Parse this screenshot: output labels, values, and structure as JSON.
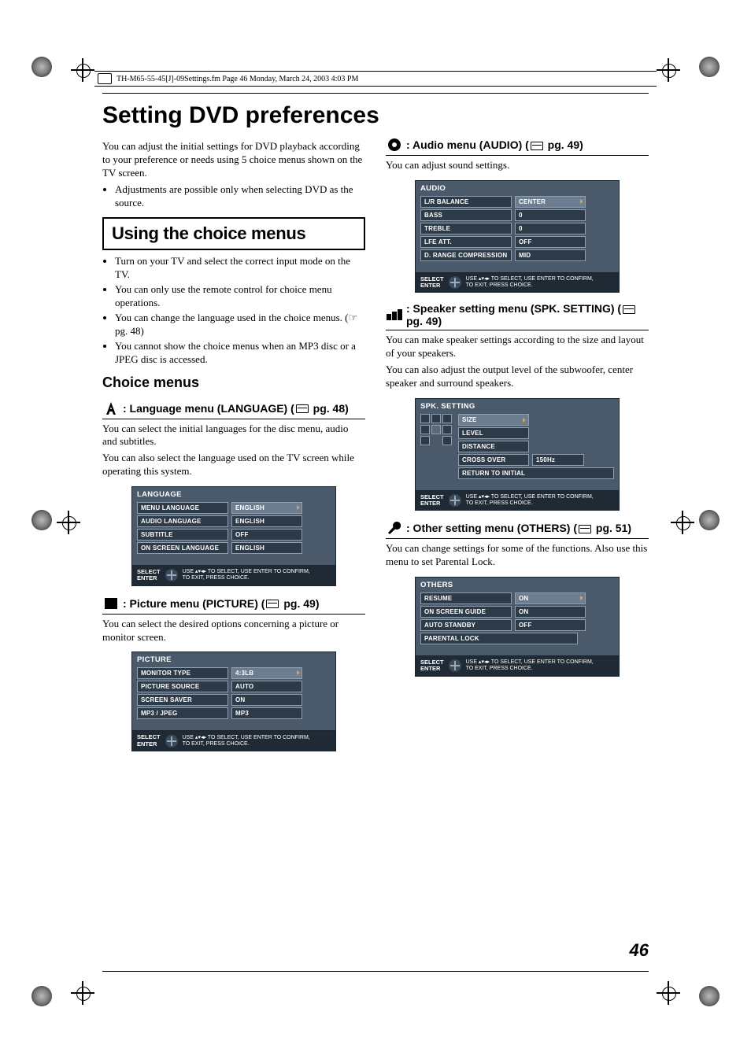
{
  "header_meta": "TH-M65-55-45[J]-09Settings.fm  Page 46  Monday, March 24, 2003  4:03 PM",
  "page_number": "46",
  "title": "Setting DVD preferences",
  "intro_p1": "You can adjust the initial settings for DVD playback according to your preference or needs using 5 choice menus shown on the TV screen.",
  "intro_bullet": "Adjustments are possible only when selecting DVD as the source.",
  "box_heading": "Using the choice menus",
  "box_bullets": [
    "Turn on your TV and select the correct input mode on the TV.",
    "You can only use the remote control for choice menu operations.",
    "You can change the language used in the choice menus. (☞ pg. 48)",
    "You cannot show the choice menus when an MP3 disc or a JPEG disc is accessed."
  ],
  "subheading": "Choice menus",
  "menus": {
    "language": {
      "heading_pre": ": Language menu (LANGUAGE) (",
      "heading_pg": " pg. 48)",
      "desc1": "You can select the initial languages for the disc menu, audio and subtitles.",
      "desc2": "You can also select the language used on the TV screen while operating this system.",
      "osd_title": "LANGUAGE",
      "rows": [
        {
          "label": "MENU LANGUAGE",
          "value": "ENGLISH",
          "hi": true
        },
        {
          "label": "AUDIO LANGUAGE",
          "value": "ENGLISH"
        },
        {
          "label": "SUBTITLE",
          "value": "OFF"
        },
        {
          "label": "ON SCREEN LANGUAGE",
          "value": "ENGLISH"
        }
      ]
    },
    "picture": {
      "heading_pre": ": Picture menu (PICTURE) (",
      "heading_pg": " pg. 49)",
      "desc1": "You can select the desired options concerning a picture or monitor screen.",
      "osd_title": "PICTURE",
      "rows": [
        {
          "label": "MONITOR TYPE",
          "value": "4:3LB",
          "hi": true
        },
        {
          "label": "PICTURE SOURCE",
          "value": "AUTO"
        },
        {
          "label": "SCREEN SAVER",
          "value": "ON"
        },
        {
          "label": "MP3 / JPEG",
          "value": "MP3"
        }
      ]
    },
    "audio": {
      "heading_pre": ": Audio menu (AUDIO) (",
      "heading_pg": " pg. 49)",
      "desc1": "You can adjust sound settings.",
      "osd_title": "AUDIO",
      "rows": [
        {
          "label": "L/R BALANCE",
          "value": "CENTER",
          "hi": true
        },
        {
          "label": "BASS",
          "value": "0"
        },
        {
          "label": "TREBLE",
          "value": "0"
        },
        {
          "label": "LFE ATT.",
          "value": "OFF"
        },
        {
          "label": "D. RANGE COMPRESSION",
          "value": "MID"
        }
      ]
    },
    "spk": {
      "heading_pre": ": Speaker setting menu (SPK. SETTING) (",
      "heading_pg": " pg. 49)",
      "desc1": "You can make speaker settings according to the size and layout of your speakers.",
      "desc2": "You can also adjust the output level of the subwoofer, center speaker and surround speakers.",
      "osd_title": "SPK. SETTING",
      "rows": [
        {
          "label": "SIZE",
          "value": "",
          "hi": true
        },
        {
          "label": "LEVEL",
          "value": ""
        },
        {
          "label": "DISTANCE",
          "value": ""
        },
        {
          "label": "CROSS OVER",
          "value": "150Hz"
        },
        {
          "label": "RETURN TO INITIAL",
          "value": ""
        }
      ]
    },
    "others": {
      "heading_pre": ": Other setting menu (OTHERS) (",
      "heading_pg": " pg. 51)",
      "desc1": "You can change settings for some of the functions. Also use this menu to set Parental Lock.",
      "osd_title": "OTHERS",
      "rows": [
        {
          "label": "RESUME",
          "value": "ON",
          "hi": true
        },
        {
          "label": "ON SCREEN GUIDE",
          "value": "ON"
        },
        {
          "label": "AUTO STANDBY",
          "value": "OFF"
        },
        {
          "label": "PARENTAL LOCK",
          "value": ""
        }
      ]
    }
  },
  "osd_footer_left1": "SELECT",
  "osd_footer_left2": "ENTER",
  "osd_footer_right1": "USE ▴▾◂▸ TO SELECT,  USE ENTER TO CONFIRM,",
  "osd_footer_right2": "TO EXIT, PRESS CHOICE."
}
